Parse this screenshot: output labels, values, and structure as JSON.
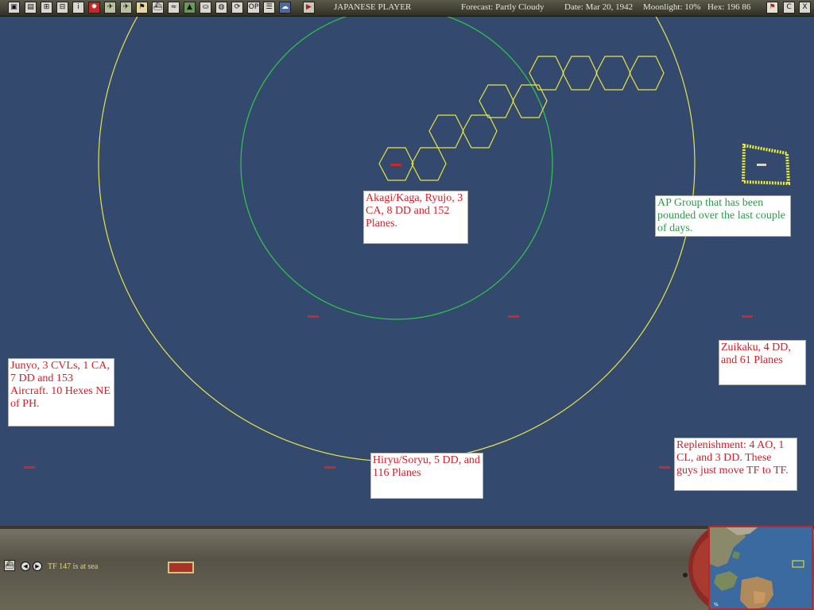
{
  "topbar": {
    "side": "JAPANESE PLAYER",
    "forecast": "Forecast: Partly Cloudy",
    "date": "Date: Mar 20, 1942",
    "moonlight": "Moonlight: 10%",
    "hex": "Hex: 196 86",
    "op_label": "OP",
    "right_buttons": {
      "c_label": "C",
      "x_label": "X"
    }
  },
  "notes": {
    "kido_butai": "Akagi/Kaga, Ryujo, 3 CA, 8 DD and 152 Planes.",
    "ap_group": "AP Group that has been pounded over the last couple of days.",
    "junyo": "Junyo, 3 CVLs, 1 CA, 7 DD and 153 Aircraft.  10 Hexes NE of PH.",
    "zuikaku": "Zuikaku, 4 DD, and 61 Planes",
    "hiryu": "Hiryu/Soryu, 5 DD, and 116 Planes",
    "replenishment": "Replenishment:  4 AO, 1 CL, and 3 DD.  These guys just move TF to TF."
  },
  "bottom": {
    "status": "TF 147 is at sea"
  },
  "colors": {
    "ocean": "#34496e",
    "range_outer": "#e6e64a",
    "range_inner": "#2fc84a",
    "hex_path": "#e6e640",
    "note_text_red": "#d2202a",
    "note_text_green": "#2e9a4a"
  }
}
